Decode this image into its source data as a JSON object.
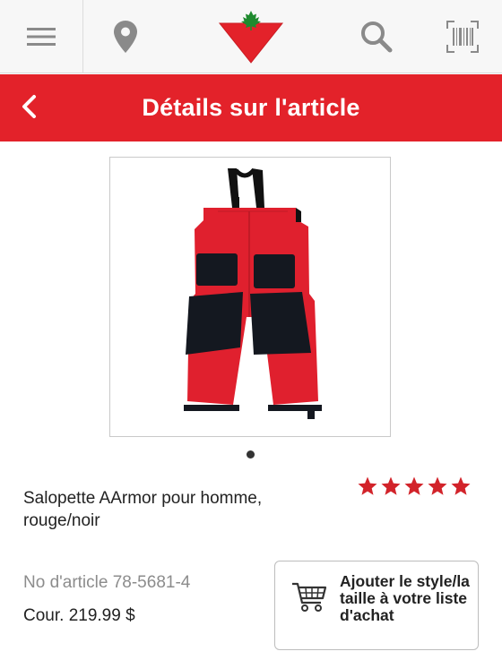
{
  "toolbar": {
    "icons": [
      "menu-icon",
      "location-pin-icon",
      "canadian-tire-logo",
      "search-icon",
      "barcode-scanner-icon"
    ]
  },
  "header": {
    "title": "Détails sur l'article",
    "back_icon": "chevron-left-icon",
    "color": "#e3222a"
  },
  "product": {
    "name": "Salopette AArmor pour homme, rouge/noir",
    "image": "red-black-snow-bib-overalls",
    "image_pager": {
      "count": 1,
      "active": 1
    },
    "rating": 5,
    "rating_max": 5,
    "article_number": "No d'article 78-5681-4",
    "price": "Cour. 219.99 $"
  },
  "actions": {
    "add_to_list": "Ajouter le style/la taille à votre liste d'achat",
    "add_to_list_icon": "shopping-cart-icon"
  }
}
